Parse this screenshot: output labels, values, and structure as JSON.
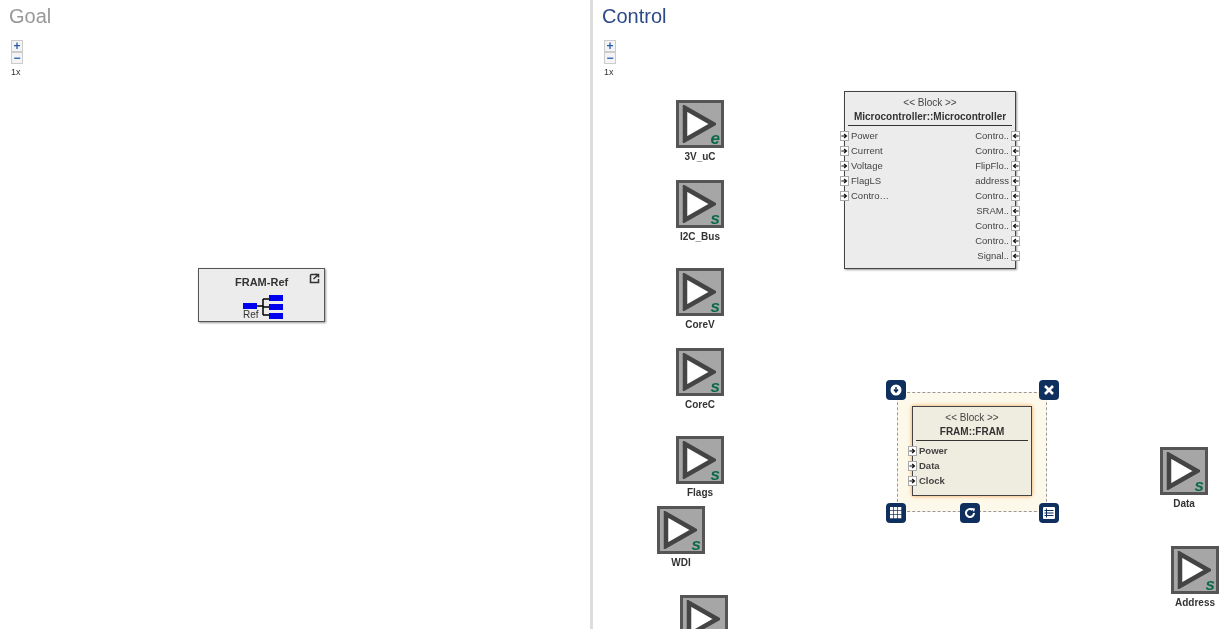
{
  "panels": [
    {
      "title": "Goal",
      "kind": "goal",
      "zoom_in": "+",
      "zoom_out": "−",
      "zoom_level": "1x",
      "references": [
        {
          "name": "FRAM-Ref",
          "port": "Ref"
        }
      ]
    },
    {
      "title": "Control",
      "kind": "control",
      "zoom_in": "+",
      "zoom_out": "−",
      "zoom_level": "1x",
      "blocks": [
        {
          "stereotype": "<< Block >>",
          "name": "Microcontroller::Microcontroller",
          "selected": false,
          "bold_ports": false,
          "inputs": [
            "Power",
            "Current",
            "Voltage",
            "FlagLS",
            "Contro…"
          ],
          "outputs": [
            "Contro..",
            "Contro..",
            "FlipFlo..",
            "address",
            "Contro..",
            "SRAM..",
            "Contro..",
            "Contro..",
            "Signal.."
          ]
        },
        {
          "stereotype": "<< Block >>",
          "name": "FRAM::FRAM",
          "selected": true,
          "bold_ports": true,
          "inputs": [
            "Power",
            "Data",
            "Clock"
          ]
        }
      ],
      "nodes": [
        {
          "kind": "signal",
          "label": "3V_uC",
          "letter": "e"
        },
        {
          "kind": "signal",
          "label": "I2C_Bus",
          "letter": "s"
        },
        {
          "kind": "signal",
          "label": "CoreV",
          "letter": "s"
        },
        {
          "kind": "signal",
          "label": "CoreC",
          "letter": "s"
        },
        {
          "kind": "signal",
          "label": "Flags",
          "letter": "s"
        },
        {
          "kind": "signal",
          "label": "WDI",
          "letter": "s"
        },
        {
          "kind": "signal",
          "label": "Data",
          "letter": "s"
        },
        {
          "kind": "signal",
          "label": "Address",
          "letter": "s"
        },
        {
          "kind": "signal"
        }
      ]
    }
  ]
}
